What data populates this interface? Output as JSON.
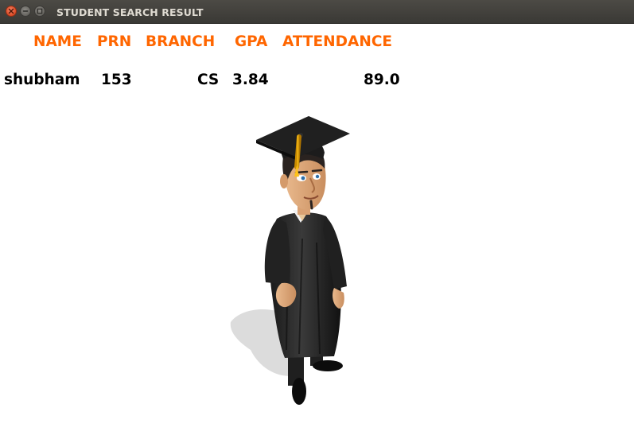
{
  "window": {
    "title": "STUDENT SEARCH RESULT"
  },
  "table": {
    "headers": [
      "NAME",
      "PRN",
      "BRANCH",
      "GPA",
      "ATTENDANCE"
    ],
    "row": {
      "name": "shubham",
      "prn": "153",
      "branch": "CS",
      "gpa": "3.84",
      "attendance": "89.0"
    }
  },
  "colors": {
    "header": "#ff6600",
    "value": "#000000",
    "titlebar": "#3c3b37"
  },
  "image": {
    "icon": "graduate-cartoon-icon"
  }
}
